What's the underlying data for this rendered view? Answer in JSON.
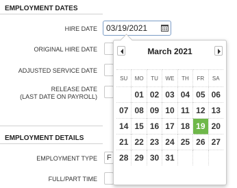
{
  "employment_dates": {
    "title": "EMPLOYMENT DATES",
    "hire_date_label": "HIRE DATE",
    "hire_date_value": "03/19/2021",
    "original_hire_date_label": "ORIGINAL HIRE DATE",
    "adjusted_service_date_label": "ADJUSTED SERVICE DATE",
    "release_date_label_line1": "RELEASE DATE",
    "release_date_label_line2": "(LAST DATE ON PAYROLL)"
  },
  "employment_details": {
    "title": "EMPLOYMENT DETAILS",
    "employment_type_label": "EMPLOYMENT TYPE",
    "employment_type_value_partial": "F",
    "full_part_time_label": "FULL/PART TIME"
  },
  "calendar": {
    "month_title": "March 2021",
    "weekdays": [
      "SU",
      "MO",
      "TU",
      "WE",
      "TH",
      "FR",
      "SA"
    ],
    "weeks": [
      [
        "",
        "01",
        "02",
        "03",
        "04",
        "05",
        "06"
      ],
      [
        "07",
        "08",
        "09",
        "10",
        "11",
        "12",
        "13"
      ],
      [
        "14",
        "15",
        "16",
        "17",
        "18",
        "19",
        "20"
      ],
      [
        "21",
        "22",
        "23",
        "24",
        "25",
        "26",
        "27"
      ],
      [
        "28",
        "29",
        "30",
        "31",
        "",
        "",
        ""
      ]
    ],
    "selected_day": "19",
    "selected_color": "#6fb84a",
    "prev_icon": "chevron-left-icon",
    "next_icon": "chevron-right-icon"
  },
  "icons": {
    "calendar": "calendar-icon"
  }
}
